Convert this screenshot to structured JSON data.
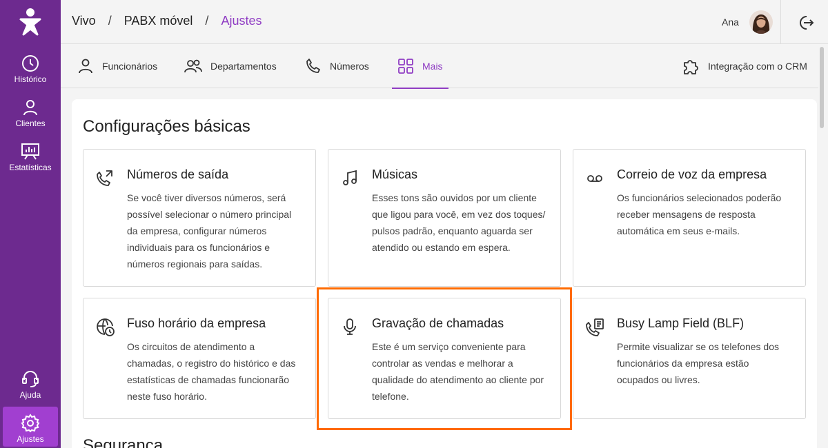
{
  "sidebar": {
    "items": [
      {
        "label": "Histórico",
        "icon": "clock-icon"
      },
      {
        "label": "Clientes",
        "icon": "person-icon"
      },
      {
        "label": "Estatísticas",
        "icon": "chart-icon"
      }
    ],
    "bottom_items": [
      {
        "label": "Ajuda",
        "icon": "headset-icon"
      },
      {
        "label": "Ajustes",
        "icon": "gear-icon"
      }
    ]
  },
  "header": {
    "breadcrumb": [
      "Vivo",
      "PABX móvel",
      "Ajustes"
    ],
    "separator": "/",
    "user_name": "Ana"
  },
  "tabs": [
    {
      "label": "Funcionários"
    },
    {
      "label": "Departamentos"
    },
    {
      "label": "Números"
    },
    {
      "label": "Mais"
    },
    {
      "label": "Integração com o CRM"
    }
  ],
  "main": {
    "section_title": "Configurações básicas",
    "next_section_title": "Segurança",
    "cards": [
      {
        "title": "Números de saída",
        "desc": "Se você tiver diversos números, será possível selecionar o número principal da empresa, configurar números individuais para os funcionários e números regionais para saídas."
      },
      {
        "title": "Músicas",
        "desc": "Esses tons são ouvidos por um cliente que ligou para você, em vez dos toques/ pulsos padrão, enquanto aguarda ser atendido ou estando em espera."
      },
      {
        "title": "Correio de voz da empresa",
        "desc": "Os funcionários selecionados poderão receber mensagens de resposta automática em seus e-mails."
      },
      {
        "title": "Fuso horário da empresa",
        "desc": "Os circuitos de atendimento a chamadas, o registro do histórico e das estatísticas de chamadas funcionarão neste fuso horário."
      },
      {
        "title": "Gravação de chamadas",
        "desc": "Este é um serviço conveniente para controlar as vendas e melhorar a qualidade do atendimento ao cliente por telefone."
      },
      {
        "title": "Busy Lamp Field (BLF)",
        "desc": "Permite visualizar se os telefones dos funcionários da empresa estão ocupados ou livres."
      }
    ]
  },
  "colors": {
    "sidebar": "#6d2a8f",
    "accent": "#8f3cc3",
    "active_nav": "#a13fd0",
    "highlight": "#ff6a00"
  }
}
